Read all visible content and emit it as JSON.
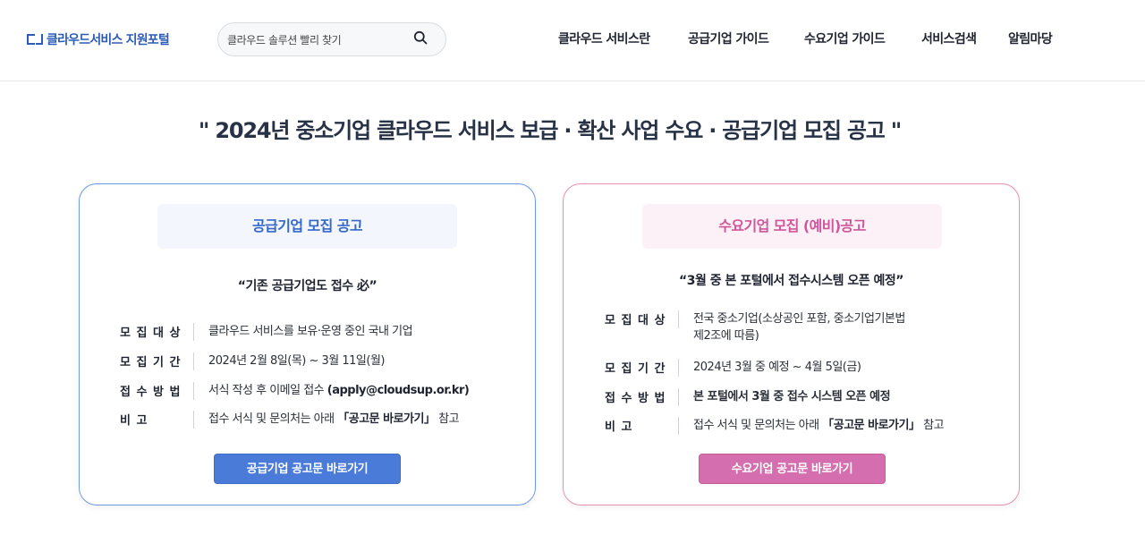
{
  "header": {
    "logo_text": "클라우드서비스 지원포털",
    "search": {
      "placeholder": "클라우드 솔루션 빨리 찾기"
    },
    "nav": [
      "클라우드 서비스란",
      "공급기업 가이드",
      "수요기업 가이드",
      "서비스검색",
      "알림마당"
    ]
  },
  "headline": "\" 2024년 중소기업 클라우드 서비스 보급 · 확산 사업 수요 · 공급기업 모집 공고 \"",
  "supply_card": {
    "title": "공급기업 모집 공고",
    "quote": "“기존 공급기업도 접수 必”",
    "rows": [
      {
        "label": "모 집 대 상",
        "value": "클라우드 서비스를 보유·운영 중인 국내 기업"
      },
      {
        "label": "모 집 기 간",
        "value": "2024년 2월 8일(목) ~ 3월 11일(월)"
      },
      {
        "label": "접 수 방 법",
        "value_prefix": "서식 작성 후 이메일 접수 ",
        "value_bold": "(apply@cloudsup.or.kr)"
      },
      {
        "label": "비 고",
        "value_prefix": "접수 서식 및 문의처는 아래 ",
        "value_bold": "「공고문 바로가기」",
        "value_suffix": " 참고"
      }
    ],
    "button": "공급기업 공고문 바로가기"
  },
  "demand_card": {
    "title": "수요기업 모집 (예비)공고",
    "quote": "“3월 중 본 포털에서 접수시스템 오픈 예정”",
    "rows": [
      {
        "label": "모 집 대 상",
        "value_line1": "전국 중소기업(소상공인 포함, 중소기업기본법",
        "value_line2": "제2조에 따름)"
      },
      {
        "label": "모 집 기 간",
        "value": "2024년 3월 중 예정 ~ 4월 5일(금)"
      },
      {
        "label": "접 수 방 법",
        "value": "본 포털에서 3월 중 접수 시스템 오픈 예정"
      },
      {
        "label": "비 고",
        "value_prefix": "접수 서식 및 문의처는 아래 ",
        "value_bold": "「공고문 바로가기」",
        "value_suffix": " 참고"
      }
    ],
    "button": "수요기업 공고문 바로가기"
  },
  "icons": {
    "search": "search-icon",
    "logo": "logo-icon"
  },
  "colors": {
    "brand": "#2c5cb8",
    "supply_accent": "#4a7bd9",
    "demand_accent": "#d46eaf"
  }
}
